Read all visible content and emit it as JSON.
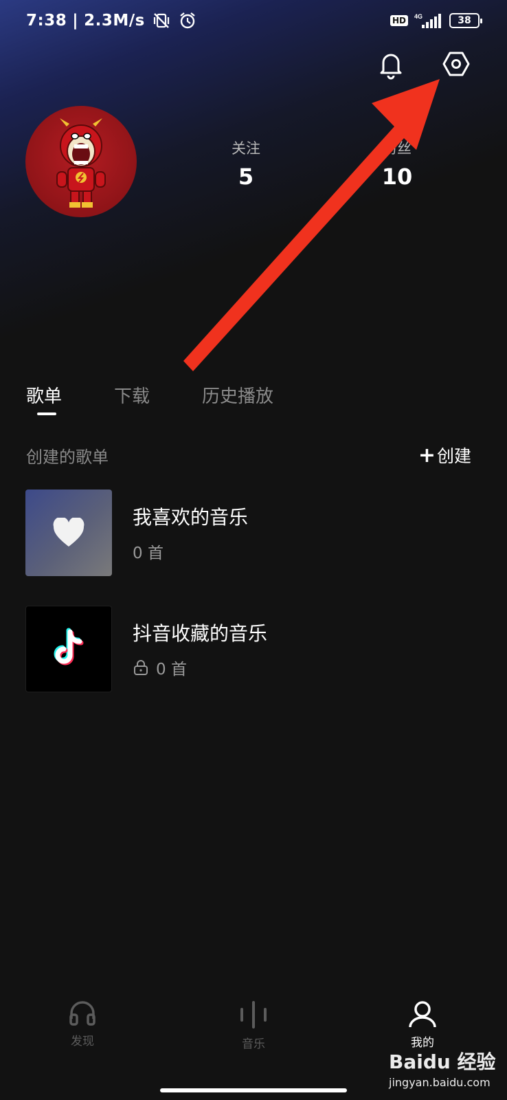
{
  "status_bar": {
    "time": "7:38",
    "separator": "|",
    "speed": "2.3M/s",
    "hd": "HD",
    "network": "4G",
    "battery": "38"
  },
  "header": {
    "icons": [
      "bell-icon",
      "settings-icon"
    ]
  },
  "profile": {
    "stats": [
      {
        "label": "关注",
        "value": "5"
      },
      {
        "label": "粉丝",
        "value": "10"
      }
    ]
  },
  "tabs": [
    {
      "label": "歌单",
      "active": true
    },
    {
      "label": "下载",
      "active": false
    },
    {
      "label": "历史播放",
      "active": false
    }
  ],
  "section": {
    "title": "创建的歌单",
    "create_label": "创建"
  },
  "playlists": [
    {
      "title": "我喜欢的音乐",
      "count": "0 首",
      "locked": false,
      "cover_icon": "heart-icon"
    },
    {
      "title": "抖音收藏的音乐",
      "count": "0 首",
      "locked": true,
      "cover_icon": "tiktok-icon"
    }
  ],
  "bottom_nav": [
    {
      "label": "发现",
      "icon": "headphones-icon",
      "active": false
    },
    {
      "label": "音乐",
      "icon": "waveform-icon",
      "active": false
    },
    {
      "label": "我的",
      "icon": "person-icon",
      "active": true
    }
  ],
  "watermark": {
    "brand": "Baidu 经验",
    "url": "jingyan.baidu.com"
  },
  "colors": {
    "background": "#121212",
    "accent_arrow": "#f0321e",
    "header_gradient": "#2b3a82"
  }
}
